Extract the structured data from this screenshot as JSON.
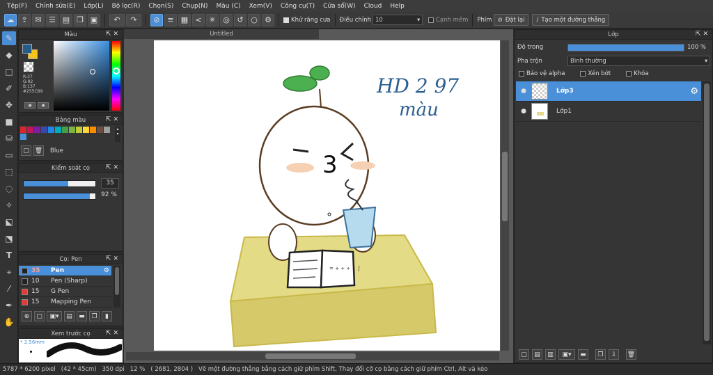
{
  "menu": [
    "Tệp(F)",
    "Chỉnh sửa(E)",
    "Lớp(L)",
    "Bộ lọc(R)",
    "Chọn(S)",
    "Chụp(N)",
    "Màu (C)",
    "Xem(V)",
    "Công cụ(T)",
    "Cửa sổ(W)",
    "Cloud",
    "Help"
  ],
  "toolbar": {
    "antialias_label": "Khử răng cưa",
    "adjust_label": "Điều chỉnh",
    "adjust_value": "10",
    "smooth_label": "Cạnh mềm",
    "key_label": "Phím",
    "reset_label": "Đặt lại",
    "line_label": "Tạo một đường thẳng"
  },
  "color_panel": {
    "title": "Màu",
    "r": "R:37",
    "g": "G:92",
    "b": "B:137",
    "hex": "#255C89",
    "main_color": "#255C89",
    "sub_color": "#F5C518"
  },
  "palette_panel": {
    "title": "Bảng màu",
    "swatches": [
      "#d9262c",
      "#c2185b",
      "#7b1fa2",
      "#3949ab",
      "#1e88e5",
      "#00acc1",
      "#43a047",
      "#7cb342",
      "#c0ca33",
      "#fdd835",
      "#fb8c00",
      "#6d4c41",
      "#9e9e9e",
      "#4a90d9"
    ],
    "color_name": "Blue"
  },
  "brush_control": {
    "title": "Kiểm soát cọ",
    "size_value": "35",
    "size_fraction": 0.62,
    "opacity_value": "92 %",
    "opacity_fraction": 0.92
  },
  "brush_panel": {
    "title": "Cọ: Pen",
    "items": [
      {
        "size": "35",
        "name": "Pen",
        "color": "#222222",
        "selected": true
      },
      {
        "size": "10",
        "name": "Pen (Sharp)",
        "color": "#222222",
        "selected": false
      },
      {
        "size": "15",
        "name": "G Pen",
        "color": "#e53935",
        "selected": false
      },
      {
        "size": "15",
        "name": "Mapping Pen",
        "color": "#e53935",
        "selected": false
      }
    ]
  },
  "preview_panel": {
    "title": "Xem trước cọ",
    "size_label": "* 2.56mm"
  },
  "document": {
    "tab_title": "Untitled"
  },
  "canvas_art": {
    "handwriting_line1": "HD 2 97",
    "handwriting_line2": "màu",
    "face_mark": "3",
    "book_text": "= + ÷ ÷ ↓ ∫"
  },
  "layer_panel": {
    "title": "Lớp",
    "opacity_label": "Độ trong",
    "opacity_value": "100 %",
    "opacity_fraction": 1.0,
    "blend_label": "Pha trộn",
    "blend_value": "Bình thường",
    "protect_alpha": "Bảo vệ alpha",
    "clip": "Xén bớt",
    "lock": "Khóa",
    "layers": [
      {
        "name": "Lớp3",
        "selected": true
      },
      {
        "name": "Lớp1",
        "selected": false
      }
    ]
  },
  "status": {
    "size": "5787 * 6200 pixel",
    "cm": "(42 * 45cm)",
    "dpi": "350 dpi",
    "zoom": "12 %",
    "coords": "( 2681, 2804 )",
    "hint": "Vẽ một đường thẳng bằng cách giữ phím Shift, Thay đổi cỡ cọ bằng cách giữ phím Ctrl, Alt và kéo"
  }
}
